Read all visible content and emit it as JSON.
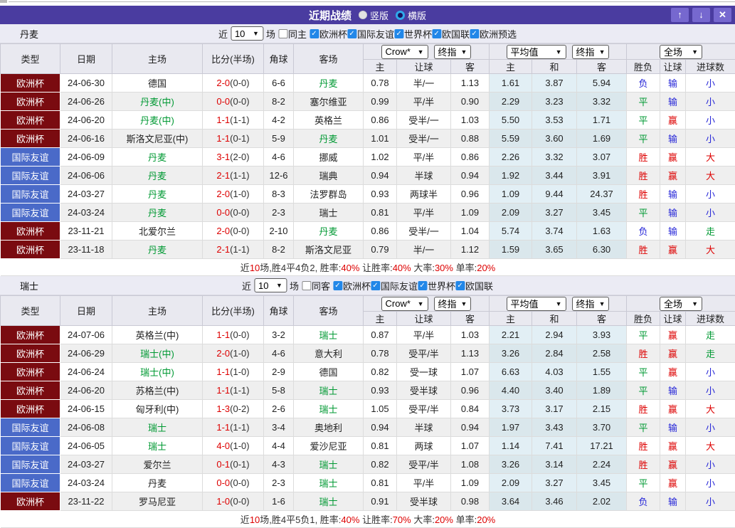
{
  "titlebar": {
    "title": "近期战绩",
    "vertical_label": "竖版",
    "horizontal_label": "横版",
    "vertical_selected": false,
    "horizontal_selected": true,
    "up_icon": "↑",
    "down_icon": "↓",
    "close_icon": "✕"
  },
  "colors": {
    "titlebar_bg": "#4a3ca0",
    "button_bg": "#7668cf",
    "badge_euro": "#7a0b10",
    "badge_friendly": "#4a6ac8",
    "win_red": "#dd0000",
    "draw_green": "#009933",
    "lose_blue": "#2626d8",
    "checkbox_blue": "#2287e8",
    "avg_col_bg": "#e2eff5"
  },
  "filter_labels": {
    "recent": "近",
    "games": "场"
  },
  "headers": {
    "type": "类型",
    "date": "日期",
    "home": "主场",
    "score": "比分(半场)",
    "corner": "角球",
    "away": "客场",
    "odds_home": "主",
    "odds_handicap": "让球",
    "odds_away": "客",
    "avg_home": "主",
    "avg_draw": "和",
    "avg_away": "客",
    "result": "胜负",
    "handicap_result": "让球",
    "goals": "进球数",
    "bookmaker_select": "Crow*",
    "final_select": "终指",
    "average_select": "平均值",
    "final_select_2": "终指",
    "scope_select": "全场"
  },
  "sections": [
    {
      "team": "丹麦",
      "filter": {
        "count": "10",
        "same_label": "同主",
        "same_checked": false,
        "competitions": [
          {
            "label": "欧洲杯",
            "checked": true
          },
          {
            "label": "国际友谊",
            "checked": true
          },
          {
            "label": "世界杯",
            "checked": true
          },
          {
            "label": "欧国联",
            "checked": true
          },
          {
            "label": "欧洲预选",
            "checked": true
          }
        ]
      },
      "rows": [
        {
          "type": "欧洲杯",
          "tc": "euro",
          "date": "24-06-30",
          "home": "德国",
          "hg": false,
          "score": "2-0",
          "half": "(0-0)",
          "corner": "6-6",
          "away": "丹麦",
          "ag": true,
          "o1": "0.78",
          "o2": "半/一",
          "o3": "1.13",
          "a1": "1.61",
          "a2": "3.87",
          "a3": "5.94",
          "r": "负",
          "rc": "b",
          "h": "输",
          "hc": "b",
          "g": "小",
          "gc": "b"
        },
        {
          "type": "欧洲杯",
          "tc": "euro",
          "date": "24-06-26",
          "home": "丹麦(中)",
          "hg": true,
          "score": "0-0",
          "half": "(0-0)",
          "corner": "8-2",
          "away": "塞尔维亚",
          "ag": false,
          "o1": "0.99",
          "o2": "平/半",
          "o3": "0.90",
          "a1": "2.29",
          "a2": "3.23",
          "a3": "3.32",
          "r": "平",
          "rc": "g",
          "h": "输",
          "hc": "b",
          "g": "小",
          "gc": "b"
        },
        {
          "type": "欧洲杯",
          "tc": "euro",
          "date": "24-06-20",
          "home": "丹麦(中)",
          "hg": true,
          "score": "1-1",
          "half": "(1-1)",
          "corner": "4-2",
          "away": "英格兰",
          "ag": false,
          "o1": "0.86",
          "o2": "受半/一",
          "o3": "1.03",
          "a1": "5.50",
          "a2": "3.53",
          "a3": "1.71",
          "r": "平",
          "rc": "g",
          "h": "赢",
          "hc": "r",
          "g": "小",
          "gc": "b"
        },
        {
          "type": "欧洲杯",
          "tc": "euro",
          "date": "24-06-16",
          "home": "斯洛文尼亚(中)",
          "hg": false,
          "score": "1-1",
          "half": "(0-1)",
          "corner": "5-9",
          "away": "丹麦",
          "ag": true,
          "o1": "1.01",
          "o2": "受半/一",
          "o3": "0.88",
          "a1": "5.59",
          "a2": "3.60",
          "a3": "1.69",
          "r": "平",
          "rc": "g",
          "h": "输",
          "hc": "b",
          "g": "小",
          "gc": "b"
        },
        {
          "type": "国际友谊",
          "tc": "friendly",
          "date": "24-06-09",
          "home": "丹麦",
          "hg": true,
          "score": "3-1",
          "half": "(2-0)",
          "corner": "4-6",
          "away": "挪威",
          "ag": false,
          "o1": "1.02",
          "o2": "平/半",
          "o3": "0.86",
          "a1": "2.26",
          "a2": "3.32",
          "a3": "3.07",
          "r": "胜",
          "rc": "r",
          "h": "赢",
          "hc": "r",
          "g": "大",
          "gc": "r"
        },
        {
          "type": "国际友谊",
          "tc": "friendly",
          "date": "24-06-06",
          "home": "丹麦",
          "hg": true,
          "score": "2-1",
          "half": "(1-1)",
          "corner": "12-6",
          "away": "瑞典",
          "ag": false,
          "o1": "0.94",
          "o2": "半球",
          "o3": "0.94",
          "a1": "1.92",
          "a2": "3.44",
          "a3": "3.91",
          "r": "胜",
          "rc": "r",
          "h": "赢",
          "hc": "r",
          "g": "大",
          "gc": "r"
        },
        {
          "type": "国际友谊",
          "tc": "friendly",
          "date": "24-03-27",
          "home": "丹麦",
          "hg": true,
          "score": "2-0",
          "half": "(1-0)",
          "corner": "8-3",
          "away": "法罗群岛",
          "ag": false,
          "o1": "0.93",
          "o2": "两球半",
          "o3": "0.96",
          "a1": "1.09",
          "a2": "9.44",
          "a3": "24.37",
          "r": "胜",
          "rc": "r",
          "h": "输",
          "hc": "b",
          "g": "小",
          "gc": "b"
        },
        {
          "type": "国际友谊",
          "tc": "friendly",
          "date": "24-03-24",
          "home": "丹麦",
          "hg": true,
          "score": "0-0",
          "half": "(0-0)",
          "corner": "2-3",
          "away": "瑞士",
          "ag": false,
          "o1": "0.81",
          "o2": "平/半",
          "o3": "1.09",
          "a1": "2.09",
          "a2": "3.27",
          "a3": "3.45",
          "r": "平",
          "rc": "g",
          "h": "输",
          "hc": "b",
          "g": "小",
          "gc": "b"
        },
        {
          "type": "欧洲杯",
          "tc": "euro",
          "date": "23-11-21",
          "home": "北爱尔兰",
          "hg": false,
          "score": "2-0",
          "half": "(0-0)",
          "corner": "2-10",
          "away": "丹麦",
          "ag": true,
          "o1": "0.86",
          "o2": "受半/一",
          "o3": "1.04",
          "a1": "5.74",
          "a2": "3.74",
          "a3": "1.63",
          "r": "负",
          "rc": "b",
          "h": "输",
          "hc": "b",
          "g": "走",
          "gc": "g"
        },
        {
          "type": "欧洲杯",
          "tc": "euro",
          "date": "23-11-18",
          "home": "丹麦",
          "hg": true,
          "score": "2-1",
          "half": "(1-1)",
          "corner": "8-2",
          "away": "斯洛文尼亚",
          "ag": false,
          "o1": "0.79",
          "o2": "半/一",
          "o3": "1.12",
          "a1": "1.59",
          "a2": "3.65",
          "a3": "6.30",
          "r": "胜",
          "rc": "r",
          "h": "赢",
          "hc": "r",
          "g": "大",
          "gc": "r"
        }
      ],
      "summary_parts": [
        {
          "t": "近",
          "r": false
        },
        {
          "t": "10",
          "r": true
        },
        {
          "t": "场,胜4平4负2, 胜率:",
          "r": false
        },
        {
          "t": "40%",
          "r": true
        },
        {
          "t": " 让胜率:",
          "r": false
        },
        {
          "t": "40%",
          "r": true
        },
        {
          "t": " 大率:",
          "r": false
        },
        {
          "t": "30%",
          "r": true
        },
        {
          "t": " 单率:",
          "r": false
        },
        {
          "t": "20%",
          "r": true
        }
      ]
    },
    {
      "team": "瑞士",
      "filter": {
        "count": "10",
        "same_label": "同客",
        "same_checked": false,
        "competitions": [
          {
            "label": "欧洲杯",
            "checked": true
          },
          {
            "label": "国际友谊",
            "checked": true
          },
          {
            "label": "世界杯",
            "checked": true
          },
          {
            "label": "欧国联",
            "checked": true
          }
        ]
      },
      "rows": [
        {
          "type": "欧洲杯",
          "tc": "euro",
          "date": "24-07-06",
          "home": "英格兰(中)",
          "hg": false,
          "score": "1-1",
          "half": "(0-0)",
          "corner": "3-2",
          "away": "瑞士",
          "ag": true,
          "o1": "0.87",
          "o2": "平/半",
          "o3": "1.03",
          "a1": "2.21",
          "a2": "2.94",
          "a3": "3.93",
          "r": "平",
          "rc": "g",
          "h": "赢",
          "hc": "r",
          "g": "走",
          "gc": "g"
        },
        {
          "type": "欧洲杯",
          "tc": "euro",
          "date": "24-06-29",
          "home": "瑞士(中)",
          "hg": true,
          "score": "2-0",
          "half": "(1-0)",
          "corner": "4-6",
          "away": "意大利",
          "ag": false,
          "o1": "0.78",
          "o2": "受平/半",
          "o3": "1.13",
          "a1": "3.26",
          "a2": "2.84",
          "a3": "2.58",
          "r": "胜",
          "rc": "r",
          "h": "赢",
          "hc": "r",
          "g": "走",
          "gc": "g"
        },
        {
          "type": "欧洲杯",
          "tc": "euro",
          "date": "24-06-24",
          "home": "瑞士(中)",
          "hg": true,
          "score": "1-1",
          "half": "(1-0)",
          "corner": "2-9",
          "away": "德国",
          "ag": false,
          "o1": "0.82",
          "o2": "受一球",
          "o3": "1.07",
          "a1": "6.63",
          "a2": "4.03",
          "a3": "1.55",
          "r": "平",
          "rc": "g",
          "h": "赢",
          "hc": "r",
          "g": "小",
          "gc": "b"
        },
        {
          "type": "欧洲杯",
          "tc": "euro",
          "date": "24-06-20",
          "home": "苏格兰(中)",
          "hg": false,
          "score": "1-1",
          "half": "(1-1)",
          "corner": "5-8",
          "away": "瑞士",
          "ag": true,
          "o1": "0.93",
          "o2": "受半球",
          "o3": "0.96",
          "a1": "4.40",
          "a2": "3.40",
          "a3": "1.89",
          "r": "平",
          "rc": "g",
          "h": "输",
          "hc": "b",
          "g": "小",
          "gc": "b"
        },
        {
          "type": "欧洲杯",
          "tc": "euro",
          "date": "24-06-15",
          "home": "匈牙利(中)",
          "hg": false,
          "score": "1-3",
          "half": "(0-2)",
          "corner": "2-6",
          "away": "瑞士",
          "ag": true,
          "o1": "1.05",
          "o2": "受平/半",
          "o3": "0.84",
          "a1": "3.73",
          "a2": "3.17",
          "a3": "2.15",
          "r": "胜",
          "rc": "r",
          "h": "赢",
          "hc": "r",
          "g": "大",
          "gc": "r"
        },
        {
          "type": "国际友谊",
          "tc": "friendly",
          "date": "24-06-08",
          "home": "瑞士",
          "hg": true,
          "score": "1-1",
          "half": "(1-1)",
          "corner": "3-4",
          "away": "奥地利",
          "ag": false,
          "o1": "0.94",
          "o2": "半球",
          "o3": "0.94",
          "a1": "1.97",
          "a2": "3.43",
          "a3": "3.70",
          "r": "平",
          "rc": "g",
          "h": "输",
          "hc": "b",
          "g": "小",
          "gc": "b"
        },
        {
          "type": "国际友谊",
          "tc": "friendly",
          "date": "24-06-05",
          "home": "瑞士",
          "hg": true,
          "score": "4-0",
          "half": "(1-0)",
          "corner": "4-4",
          "away": "爱沙尼亚",
          "ag": false,
          "o1": "0.81",
          "o2": "两球",
          "o3": "1.07",
          "a1": "1.14",
          "a2": "7.41",
          "a3": "17.21",
          "r": "胜",
          "rc": "r",
          "h": "赢",
          "hc": "r",
          "g": "大",
          "gc": "r"
        },
        {
          "type": "国际友谊",
          "tc": "friendly",
          "date": "24-03-27",
          "home": "爱尔兰",
          "hg": false,
          "score": "0-1",
          "half": "(0-1)",
          "corner": "4-3",
          "away": "瑞士",
          "ag": true,
          "o1": "0.82",
          "o2": "受平/半",
          "o3": "1.08",
          "a1": "3.26",
          "a2": "3.14",
          "a3": "2.24",
          "r": "胜",
          "rc": "r",
          "h": "赢",
          "hc": "r",
          "g": "小",
          "gc": "b"
        },
        {
          "type": "国际友谊",
          "tc": "friendly",
          "date": "24-03-24",
          "home": "丹麦",
          "hg": false,
          "score": "0-0",
          "half": "(0-0)",
          "corner": "2-3",
          "away": "瑞士",
          "ag": true,
          "o1": "0.81",
          "o2": "平/半",
          "o3": "1.09",
          "a1": "2.09",
          "a2": "3.27",
          "a3": "3.45",
          "r": "平",
          "rc": "g",
          "h": "赢",
          "hc": "r",
          "g": "小",
          "gc": "b"
        },
        {
          "type": "欧洲杯",
          "tc": "euro",
          "date": "23-11-22",
          "home": "罗马尼亚",
          "hg": false,
          "score": "1-0",
          "half": "(0-0)",
          "corner": "1-6",
          "away": "瑞士",
          "ag": true,
          "o1": "0.91",
          "o2": "受半球",
          "o3": "0.98",
          "a1": "3.64",
          "a2": "3.46",
          "a3": "2.02",
          "r": "负",
          "rc": "b",
          "h": "输",
          "hc": "b",
          "g": "小",
          "gc": "b"
        }
      ],
      "summary_parts": [
        {
          "t": "近",
          "r": false
        },
        {
          "t": "10",
          "r": true
        },
        {
          "t": "场,胜4平5负1, 胜率:",
          "r": false
        },
        {
          "t": "40%",
          "r": true
        },
        {
          "t": " 让胜率:",
          "r": false
        },
        {
          "t": "70%",
          "r": true
        },
        {
          "t": " 大率:",
          "r": false
        },
        {
          "t": "20%",
          "r": true
        },
        {
          "t": " 单率:",
          "r": false
        },
        {
          "t": "20%",
          "r": true
        }
      ]
    }
  ]
}
